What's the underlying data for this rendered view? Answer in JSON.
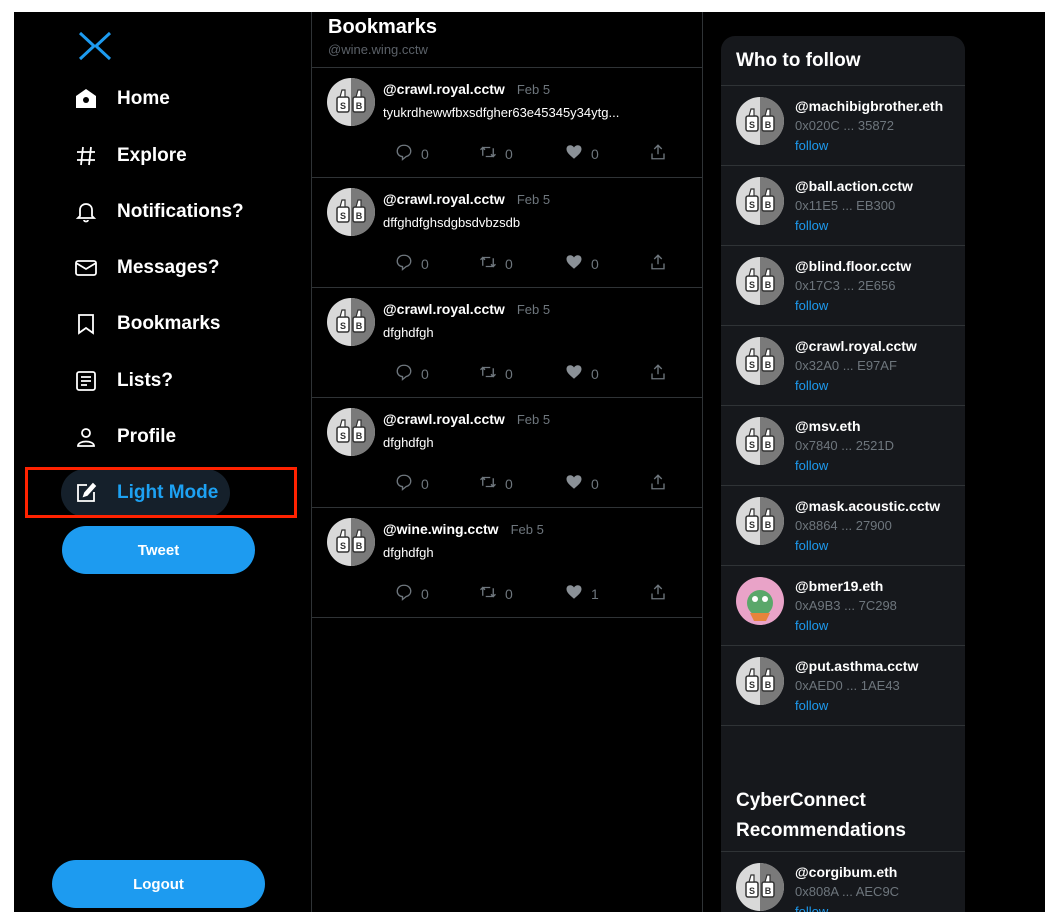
{
  "sidebar": {
    "logo_icon": "cyberconnect-x-logo-icon",
    "items": [
      {
        "label": "Home",
        "icon": "home-icon"
      },
      {
        "label": "Explore",
        "icon": "hashtag-icon"
      },
      {
        "label": "Notifications?",
        "icon": "bell-icon"
      },
      {
        "label": "Messages?",
        "icon": "envelope-icon"
      },
      {
        "label": "Bookmarks",
        "icon": "bookmark-icon"
      },
      {
        "label": "Lists?",
        "icon": "list-icon"
      },
      {
        "label": "Profile",
        "icon": "person-icon"
      },
      {
        "label": "Light Mode",
        "icon": "edit-brush-icon"
      }
    ],
    "tweet_label": "Tweet",
    "logout_label": "Logout"
  },
  "feed": {
    "title": "Bookmarks",
    "subtitle": "@wine.wing.cctw",
    "posts": [
      {
        "handle": "@crawl.royal.cctw",
        "date": "Feb 5",
        "text": "tyukrdhewwfbxsdfgher63e45345y34ytg...",
        "replies": "0",
        "retweets": "0",
        "likes": "0"
      },
      {
        "handle": "@crawl.royal.cctw",
        "date": "Feb 5",
        "text": "dffghdfghsdgbsdvbzsdb",
        "replies": "0",
        "retweets": "0",
        "likes": "0"
      },
      {
        "handle": "@crawl.royal.cctw",
        "date": "Feb 5",
        "text": "dfghdfgh",
        "replies": "0",
        "retweets": "0",
        "likes": "0"
      },
      {
        "handle": "@crawl.royal.cctw",
        "date": "Feb 5",
        "text": "dfghdfgh",
        "replies": "0",
        "retweets": "0",
        "likes": "0"
      },
      {
        "handle": "@wine.wing.cctw",
        "date": "Feb 5",
        "text": "dfghdfgh",
        "replies": "0",
        "retweets": "0",
        "likes": "1"
      }
    ]
  },
  "who_to_follow": {
    "title": "Who to follow",
    "follow_label": "follow",
    "items": [
      {
        "handle": "@machibigbrother.eth",
        "address": "0x020C ... 35872"
      },
      {
        "handle": "@ball.action.cctw",
        "address": "0x11E5 ... EB300"
      },
      {
        "handle": "@blind.floor.cctw",
        "address": "0x17C3 ... 2E656"
      },
      {
        "handle": "@crawl.royal.cctw",
        "address": "0x32A0 ... E97AF"
      },
      {
        "handle": "@msv.eth",
        "address": "0x7840 ... 2521D"
      },
      {
        "handle": "@mask.acoustic.cctw",
        "address": "0x8864 ... 27900"
      },
      {
        "handle": "@bmer19.eth",
        "address": "0xA9B3 ... 7C298"
      },
      {
        "handle": "@put.asthma.cctw",
        "address": "0xAED0 ... 1AE43"
      }
    ]
  },
  "recommendations": {
    "title_line1": "CyberConnect",
    "title_line2": "Recommendations",
    "items": [
      {
        "handle": "@corgibum.eth",
        "address": "0x808A ... AEC9C",
        "follow_label": "follow"
      }
    ]
  },
  "colors": {
    "accent": "#1d9bf0",
    "background": "#000000",
    "panel": "#16181c",
    "border": "#2f3336",
    "muted": "#6e767d",
    "highlight_box": "#ff2200"
  }
}
